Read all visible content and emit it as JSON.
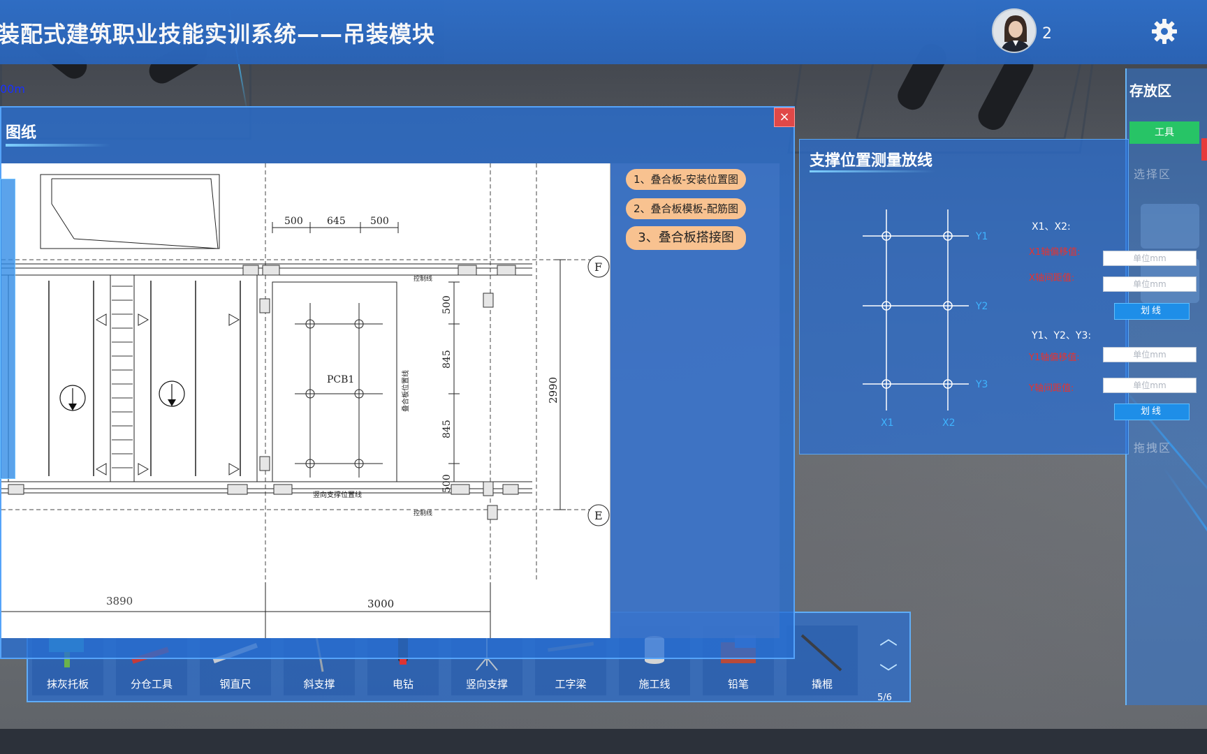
{
  "header": {
    "title": "装配式建筑职业技能实训系统——吊装模块",
    "user_count": "2"
  },
  "scene": {
    "depth_label": "00m"
  },
  "drawing_panel": {
    "title": "图纸",
    "close": "×",
    "tabs": [
      {
        "label": "1、叠合板-安装位置图"
      },
      {
        "label": "2、叠合板模板-配筋图"
      },
      {
        "label": "3、叠合板搭接图"
      }
    ],
    "dims": {
      "d500a": "500",
      "d645": "645",
      "d500b": "500",
      "v500a": "500",
      "v845a": "845",
      "v845b": "845",
      "v500b": "500",
      "d2990": "2990",
      "d3890": "3890",
      "d3000": "3000",
      "pcb": "PCB1",
      "vertical_support": "竖向支撑位置线",
      "slab_label": "叠合板位置线",
      "control_line_top": "控制线",
      "control_line_bottom": "控制线",
      "axis_f": "F",
      "axis_e": "E"
    }
  },
  "measure_panel": {
    "title": "支撑位置测量放线",
    "grid": {
      "x_labels": [
        "X1",
        "X2"
      ],
      "y_labels": [
        "Y1",
        "Y2",
        "Y3"
      ]
    },
    "x_group_label": "X1、X2:",
    "x_field1_label": "X1轴偏移值:",
    "x_field2_label": "X轴间距值:",
    "x_field1_placeholder": "单位mm",
    "x_field2_placeholder": "单位mm",
    "x_button": "划线",
    "y_group_label": "Y1、Y2、Y3:",
    "y_field1_label": "Y1轴偏移值:",
    "y_field2_label": "Y轴间距值:",
    "y_field1_placeholder": "单位mm",
    "y_field2_placeholder": "单位mm",
    "y_button": "划线"
  },
  "storage_panel": {
    "title": "存放区",
    "tool_button": "工具",
    "select_area": "选择区",
    "drag_area": "拖拽区"
  },
  "toolbar": {
    "tools": [
      {
        "label": "抹灰托板"
      },
      {
        "label": "分仓工具"
      },
      {
        "label": "钢直尺"
      },
      {
        "label": "斜支撑"
      },
      {
        "label": "电钻"
      },
      {
        "label": "竖向支撑"
      },
      {
        "label": "工字梁"
      },
      {
        "label": "施工线"
      },
      {
        "label": "铅笔"
      },
      {
        "label": "撬棍"
      }
    ],
    "page_up": "︿",
    "page_down": "﹀",
    "page": "5/6"
  },
  "colors": {
    "header_blue": "#2f6fc8",
    "panel_blue": "#2a6ed2",
    "tab_orange": "#f8c290",
    "button_blue": "#1e8ee8",
    "tool_green": "#27c466",
    "label_red": "#e8322e",
    "grid_cyan": "#3fb4ff"
  }
}
